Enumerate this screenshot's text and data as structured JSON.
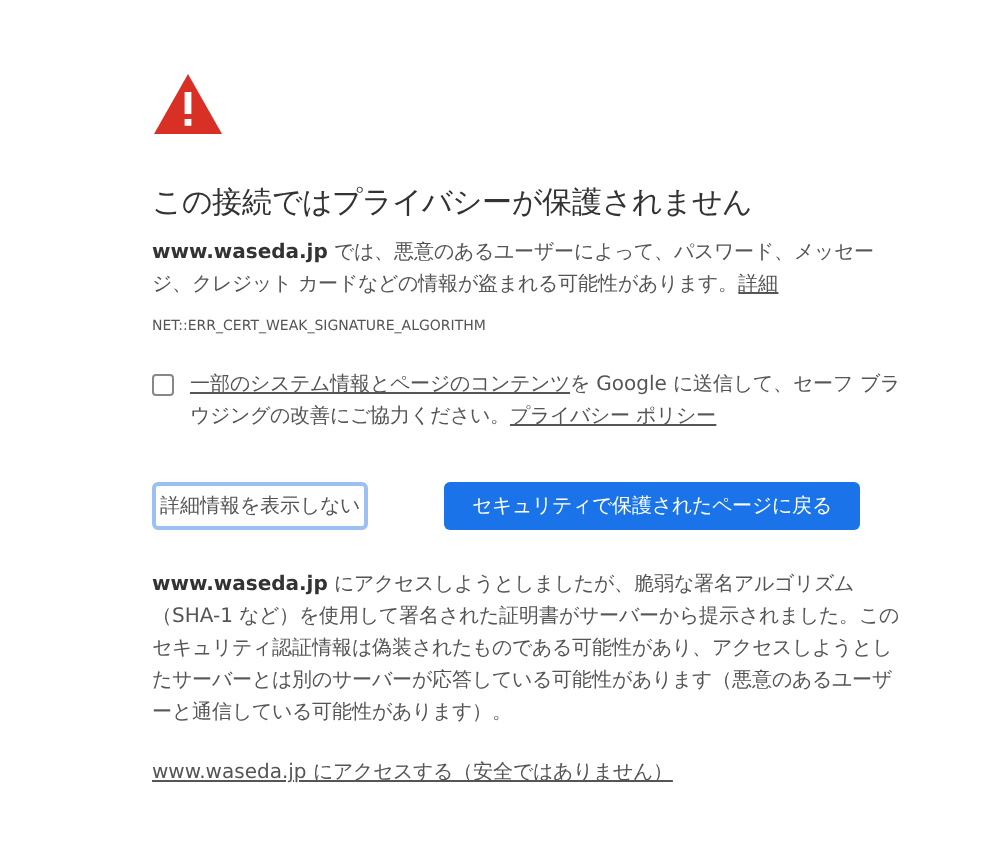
{
  "title": "この接続ではプライバシーが保護されません",
  "summary": {
    "text": "**www.waseda.jp** では、悪意のあるユーザーによって、パスワード、メッセージ、クレジット カードなどの情報が盗まれる可能性があります。",
    "link": "詳細"
  },
  "error_code": "NET::ERR_CERT_WEAK_SIGNATURE_ALGORITHM",
  "report": {
    "checked": false,
    "link": "一部のシステム情報とページのコンテンツ",
    "text": "を Google に送信して、セーフ ブラウジングの改善にご協力ください。",
    "policy_link": "プライバシー ポリシー"
  },
  "buttons": [
    {
      "kind": "outline",
      "label": "詳細情報を表示しない"
    },
    {
      "kind": "primary",
      "label": "セキュリティで保護されたページに戻る"
    }
  ],
  "details": "**www.waseda.jp** にアクセスしようとしましたが、脆弱な署名アルゴリズム（SHA-1 など）を使用して署名された証明書がサーバーから提示されました。このセキュリティ認証情報は偽装されたものである可能性があり、アクセスしようとしたサーバーとは別のサーバーが応答している可能性があります（悪意のあるユーザーと通信している可能性があります）。",
  "proceed_link": "www.waseda.jp にアクセスする（安全ではありません）"
}
